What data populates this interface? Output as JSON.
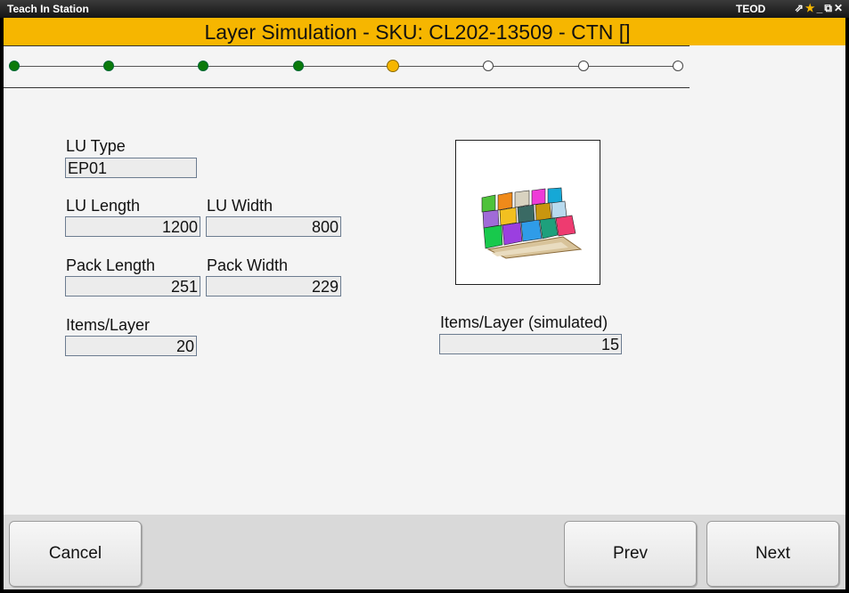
{
  "titlebar": {
    "title": "Teach In Station",
    "right_label": "TEOD"
  },
  "header": {
    "title": "Layer Simulation - SKU: CL202-13509 - CTN []"
  },
  "progress": {
    "steps": [
      "done",
      "done",
      "done",
      "done",
      "current",
      "todo",
      "todo",
      "todo"
    ],
    "colors": {
      "done": "#0a7a0a",
      "current": "#f6b600",
      "todo": "#ffffff"
    }
  },
  "form": {
    "lu_type": {
      "label": "LU Type",
      "value": "EP01"
    },
    "lu_length": {
      "label": "LU Length",
      "value": "1200"
    },
    "lu_width": {
      "label": "LU Width",
      "value": "800"
    },
    "pack_length": {
      "label": "Pack Length",
      "value": "251"
    },
    "pack_width": {
      "label": "Pack Width",
      "value": "229"
    },
    "items_layer": {
      "label": "Items/Layer",
      "value": "20"
    },
    "items_layer_simulated": {
      "label": "Items/Layer (simulated)",
      "value": "15"
    }
  },
  "footer": {
    "cancel": "Cancel",
    "prev": "Prev",
    "next": "Next"
  },
  "colors": {
    "accent": "#f6b600",
    "field_bg": "#ececec",
    "field_border": "#6c7c90"
  }
}
